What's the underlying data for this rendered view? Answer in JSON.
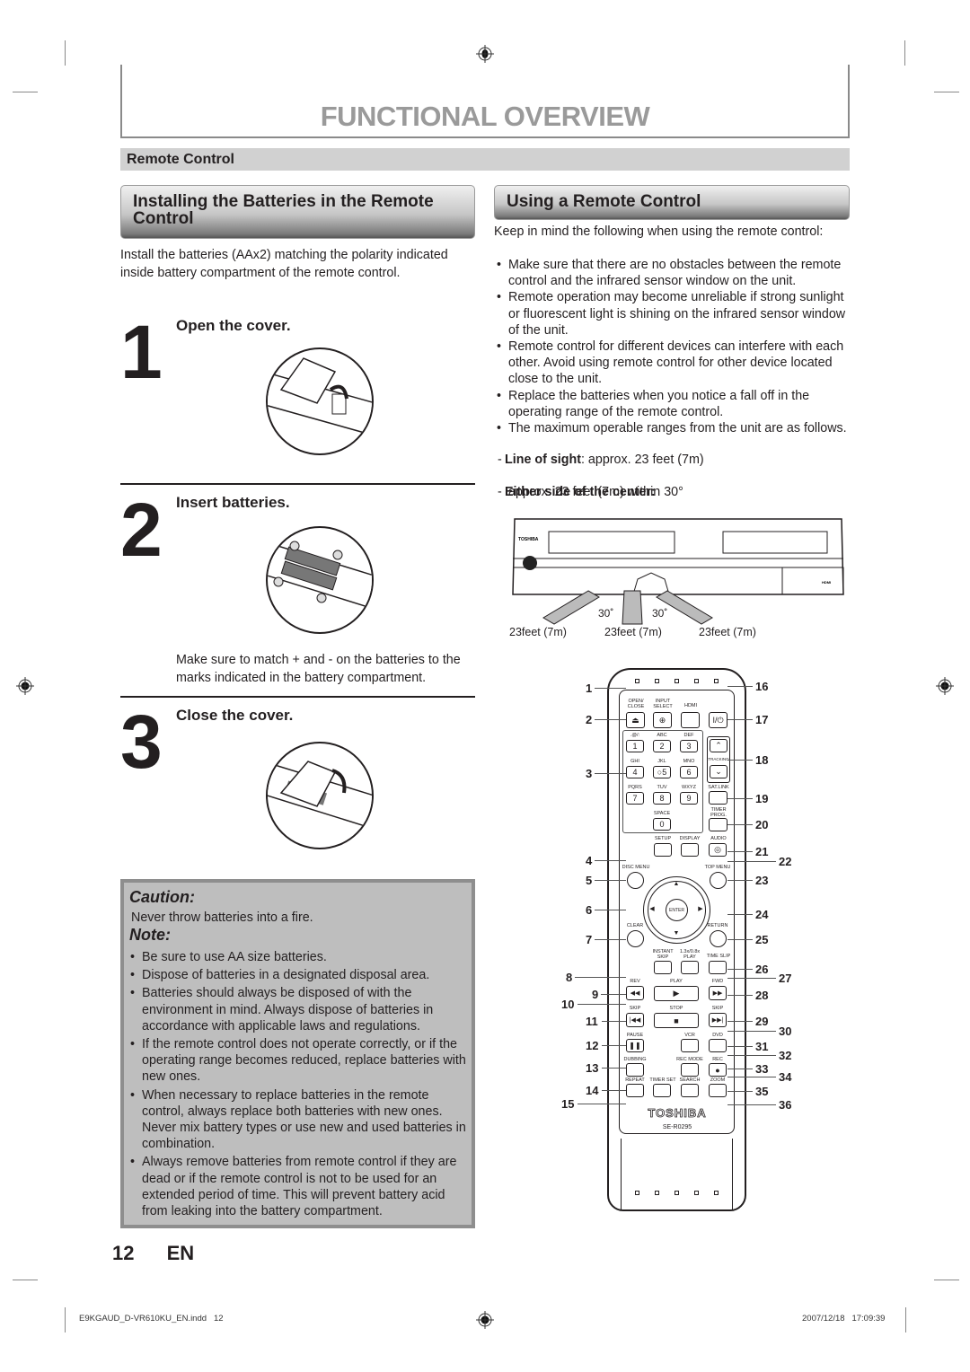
{
  "page": {
    "title": "FUNCTIONAL OVERVIEW",
    "section": "Remote Control",
    "page_number": "12",
    "language": "EN",
    "slug_file": "E9KGAUD_D-VR610KU_EN.indd   12",
    "slug_date": "2007/12/18   17:09:39"
  },
  "left": {
    "heading": "Installing the Batteries in the Remote Control",
    "intro": "Install the batteries (AAx2) matching the polarity indicated inside battery compartment of the remote control.",
    "steps": [
      {
        "num": "1",
        "title": "Open the cover."
      },
      {
        "num": "2",
        "title": "Insert batteries.",
        "note": "Make sure to match + and - on the batteries to the marks indicated in the battery compartment."
      },
      {
        "num": "3",
        "title": "Close the cover."
      }
    ],
    "caution_heading": "Caution:",
    "caution_text": "Never throw batteries into a fire.",
    "note_heading": "Note:",
    "notes": [
      "Be sure to use AA size batteries.",
      "Dispose of batteries in a designated disposal area.",
      "Batteries should always be disposed of with the environment in mind. Always dispose of batteries in accordance with applicable laws and regulations.",
      "If the remote control does not operate correctly, or if the operating range becomes reduced, replace batteries with new ones.",
      "When necessary to replace batteries in the remote control, always replace both batteries with new ones. Never mix battery types or use new and used batteries in combination.",
      "Always remove batteries from remote control if they are dead or if the remote control is not to be used for an extended period of time. This will prevent battery acid from leaking into the battery compartment."
    ]
  },
  "right": {
    "heading": "Using a Remote Control",
    "intro": "Keep in mind the following when using the remote control:",
    "bullets": [
      "Make sure that there are no obstacles between the remote control and the infrared sensor window on the unit.",
      "Remote operation may become unreliable if strong sunlight or fluorescent light is shining on the infrared sensor window of the unit.",
      "Remote control for different devices can interfere with each other. Avoid using remote control for other device located close to the unit.",
      "Replace the batteries when you notice a fall off in the operating range of the remote control.",
      "The maximum operable ranges from the unit are as follows."
    ],
    "range1_label": "Line of sight",
    "range1_value": ": approx. 23 feet (7m)",
    "range2_label": "Either side of the center:",
    "range2_value": "approx. 23 feet (7m) within 30°",
    "diagram": {
      "angle_left": "30˚",
      "angle_right": "30˚",
      "dist_left": "23feet (7m)",
      "dist_center": "23feet (7m)",
      "dist_right": "23feet (7m)",
      "brand": "TOSHIBA",
      "hdmi": "HDMI"
    }
  },
  "remote": {
    "brand": "TOSHIBA",
    "model": "SE-R0295",
    "labels": {
      "open_close": "OPEN/ CLOSE",
      "input_select": "INPUT SELECT",
      "hdmi": "HDMI",
      "power": "I/⏻",
      "k1s": ".@/:",
      "k2s": "ABC",
      "k3s": "DEF",
      "k4s": "GHI",
      "k5s": "JKL",
      "k6s": "MNO",
      "k7s": "PQRS",
      "k8s": "TUV",
      "k9s": "WXYZ",
      "k0s": "SPACE",
      "k1": "1",
      "k2": "2",
      "k3": "3",
      "k4": "4",
      "k5": "○5",
      "k6": "6",
      "k7": "7",
      "k8": "8",
      "k9": "9",
      "k0": "0",
      "tracking": "TRACKING",
      "sat_link": "SAT.LINK",
      "timer_prog": "TIMER PROG.",
      "setup": "SETUP",
      "display": "DISPLAY",
      "audio": "AUDIO",
      "disc_menu": "DISC MENU",
      "top_menu": "TOP MENU",
      "enter": "ENTER",
      "clear": "CLEAR",
      "return": "RETURN",
      "instant_skip": "INSTANT SKIP",
      "speed_play": "1.3x/0.8x PLAY",
      "time_slip": "TIME SLIP",
      "rev": "REV",
      "play": "PLAY",
      "fwd": "FWD",
      "skip_back": "SKIP",
      "stop": "STOP",
      "skip_fwd": "SKIP",
      "pause": "PAUSE",
      "vcr": "VCR",
      "dvd": "DVD",
      "dubbing": "DUBBING",
      "rec_mode": "REC MODE",
      "rec": "REC",
      "repeat": "REPEAT",
      "timer_set": "TIMER SET",
      "search": "SEARCH",
      "zoom": "ZOOM"
    },
    "callouts_left": [
      "1",
      "2",
      "3",
      "4",
      "5",
      "6",
      "7",
      "8",
      "9",
      "10",
      "11",
      "12",
      "13",
      "14",
      "15"
    ],
    "callouts_right": [
      "16",
      "17",
      "18",
      "19",
      "20",
      "21",
      "22",
      "23",
      "24",
      "25",
      "26",
      "27",
      "28",
      "29",
      "30",
      "31",
      "32",
      "33",
      "34",
      "35",
      "36"
    ]
  }
}
